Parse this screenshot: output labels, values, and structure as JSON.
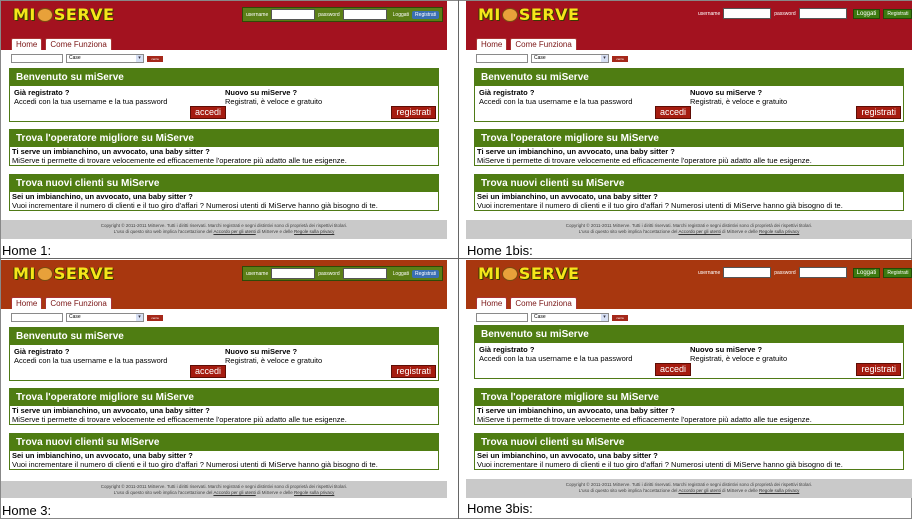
{
  "logo": {
    "left": "MI",
    "right": "SERVE"
  },
  "login": {
    "username_label": "username",
    "password_label": "password",
    "login_button": "Loggati",
    "register_button": "Registrati",
    "or_text": "oppure",
    "register_link": "Registrati"
  },
  "tabs": [
    "Home",
    "Come Funziona"
  ],
  "search": {
    "select_value": "Case",
    "button": "cerca"
  },
  "welcome": {
    "title": "Benvenuto su miServe",
    "registered_q": "Già registrato ?",
    "registered_text": "Accedi con la tua username e la tua password",
    "login_button": "accedi",
    "new_q": "Nuovo su miServe ?",
    "new_text": "Registrati, è veloce e gratuito",
    "register_button": "registrati"
  },
  "operator": {
    "title": "Trova l'operatore migliore su MiServe",
    "q": "Ti serve un imbianchino, un avvocato, una baby sitter ?",
    "text": "MiServe ti permette di trovare velocemente ed efficacemente l'operatore più adatto alle tue esigenze."
  },
  "clients": {
    "title": "Trova nuovi clienti su MiServe",
    "q": "Sei un imbianchino, un avvocato, una baby sitter ?",
    "text": "Vuoi incrementare il numero di clienti e il tuo giro d'affari ? Numerosi utenti di MiServe hanno già bisogno di te."
  },
  "footer": {
    "line1": "Copyright © 2011-2011 MiServe. Tutti i diritti riservati. Marchi registrati e segni distintivi sono di proprietà dei rispettivi titolari.",
    "line2": "L'uso di questo sito web implica l'accettazione del",
    "link1": "Accordo per gli utenti",
    "line2b": "di MiServe e delle",
    "link2": "Regole sulla privacy"
  },
  "captions": [
    "Home 1:",
    "Home 1bis:",
    "Home 3:",
    "Home 3bis:"
  ],
  "colors": {
    "header_red": "#a3121f",
    "header_orange": "#a8370f",
    "green": "#4f7d12",
    "button_red": "#a51c10",
    "footer_grey": "#c9c9c9"
  }
}
